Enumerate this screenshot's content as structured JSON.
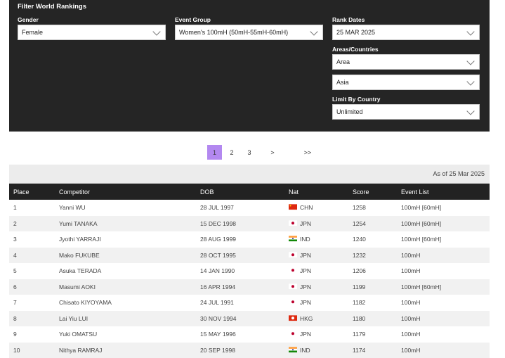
{
  "filter": {
    "title": "Filter World Rankings",
    "gender": {
      "label": "Gender",
      "value": "Female"
    },
    "event_group": {
      "label": "Event Group",
      "value": "Women's 100mH (50mH-55mH-60mH)"
    },
    "rank_dates": {
      "label": "Rank Dates",
      "value": "25 MAR 2025"
    },
    "areas": {
      "label": "Areas/Countries",
      "type_value": "Area",
      "area_value": "Asia"
    },
    "limit": {
      "label": "Limit By Country",
      "value": "Unlimited"
    }
  },
  "pagination": {
    "pages": [
      "1",
      "2",
      "3"
    ],
    "next": ">",
    "last": ">>",
    "current": "1"
  },
  "as_of": "As of 25 Mar 2025",
  "table": {
    "headers": [
      "Place",
      "Competitor",
      "DOB",
      "Nat",
      "Score",
      "Event List"
    ],
    "rows": [
      {
        "place": "1",
        "name": "Yanni WU",
        "dob": "28 JUL 1997",
        "nat": "CHN",
        "score": "1258",
        "events": "100mH [60mH]"
      },
      {
        "place": "2",
        "name": "Yumi TANAKA",
        "dob": "15 DEC 1998",
        "nat": "JPN",
        "score": "1254",
        "events": "100mH [60mH]"
      },
      {
        "place": "3",
        "name": "Jyothi YARRAJI",
        "dob": "28 AUG 1999",
        "nat": "IND",
        "score": "1240",
        "events": "100mH [60mH]"
      },
      {
        "place": "4",
        "name": "Mako FUKUBE",
        "dob": "28 OCT 1995",
        "nat": "JPN",
        "score": "1232",
        "events": "100mH"
      },
      {
        "place": "5",
        "name": "Asuka TERADA",
        "dob": "14 JAN 1990",
        "nat": "JPN",
        "score": "1206",
        "events": "100mH"
      },
      {
        "place": "6",
        "name": "Masumi AOKI",
        "dob": "16 APR 1994",
        "nat": "JPN",
        "score": "1199",
        "events": "100mH [60mH]"
      },
      {
        "place": "7",
        "name": "Chisato KIYOYAMA",
        "dob": "24 JUL 1991",
        "nat": "JPN",
        "score": "1182",
        "events": "100mH"
      },
      {
        "place": "8",
        "name": "Lai Yiu LUI",
        "dob": "30 NOV 1994",
        "nat": "HKG",
        "score": "1180",
        "events": "100mH"
      },
      {
        "place": "9",
        "name": "Yuki OMATSU",
        "dob": "15 MAY 1996",
        "nat": "JPN",
        "score": "1179",
        "events": "100mH"
      },
      {
        "place": "10",
        "name": "Nithya RAMRAJ",
        "dob": "20 SEP 1998",
        "nat": "IND",
        "score": "1174",
        "events": "100mH"
      }
    ]
  },
  "colors": {
    "panel": "#252525",
    "accent": "#b388f0"
  }
}
